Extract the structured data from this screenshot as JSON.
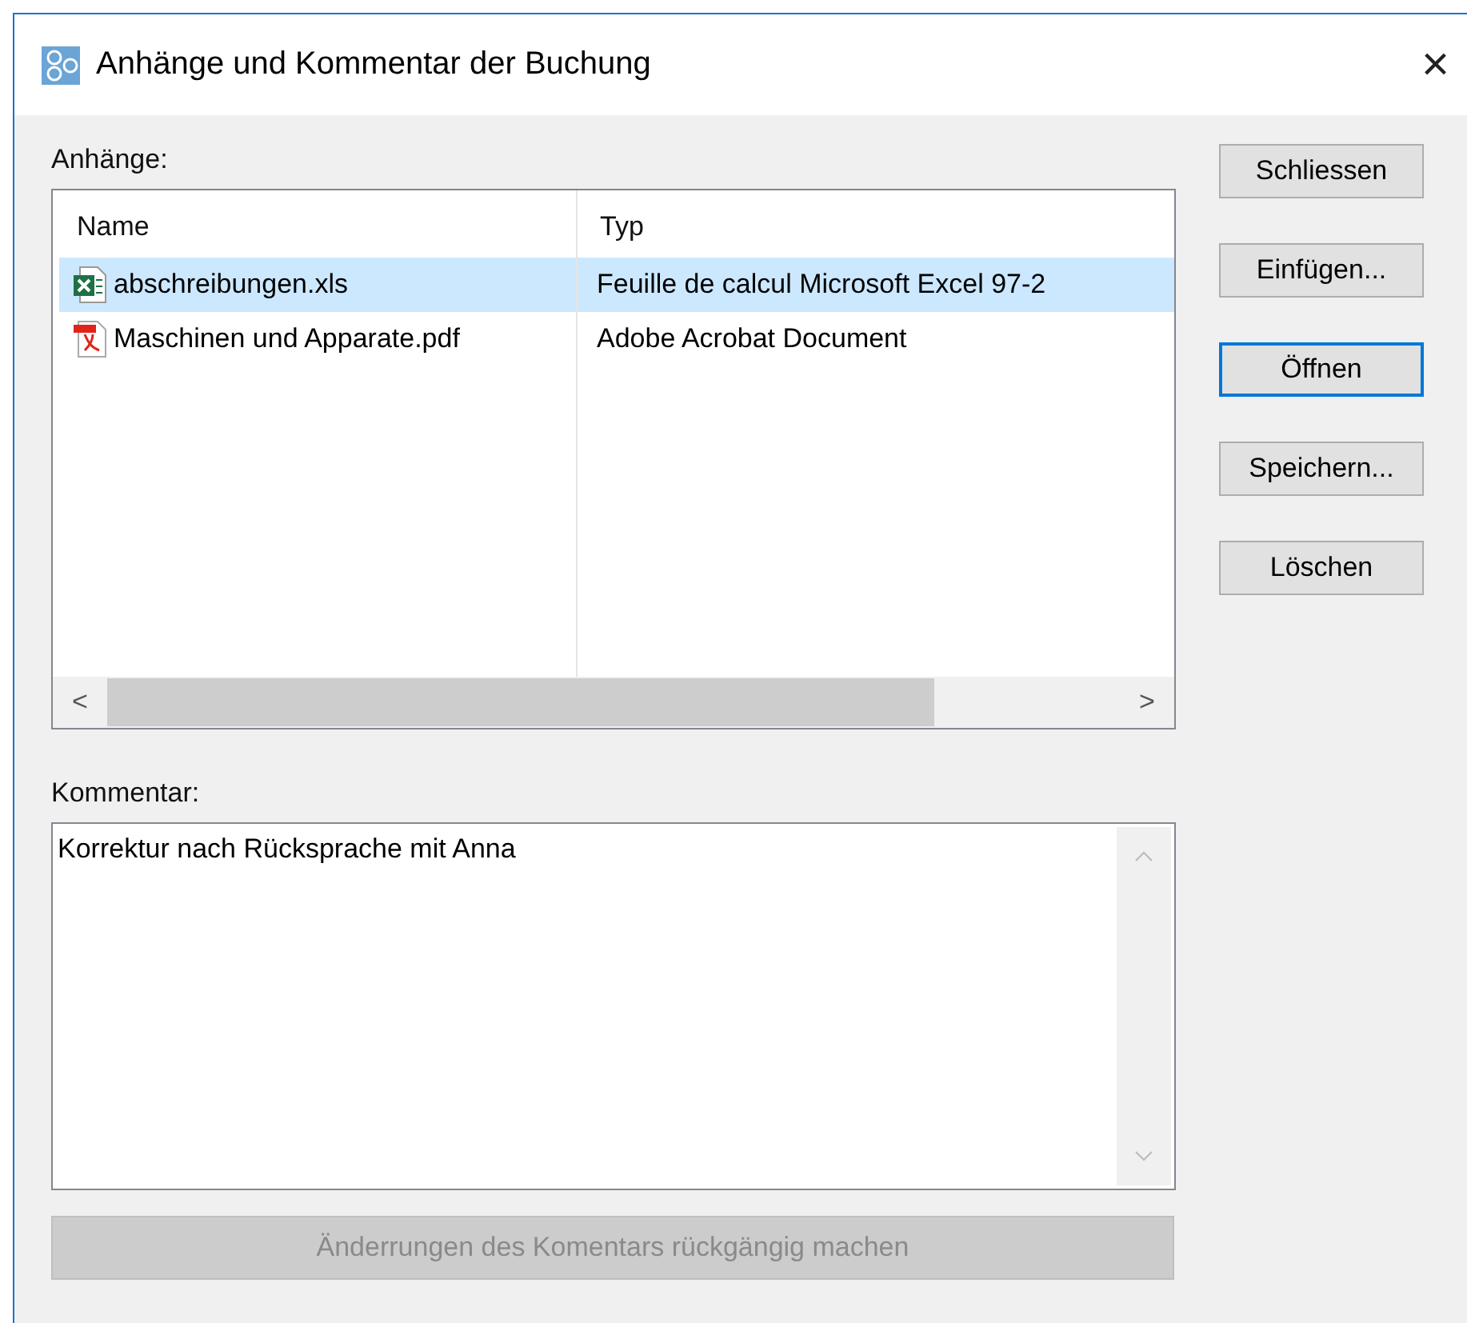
{
  "window": {
    "title": "Anhänge und Kommentar der Buchung",
    "close": "×"
  },
  "attachments": {
    "label": "Anhänge:",
    "columns": [
      "Name",
      "Typ"
    ],
    "rows": [
      {
        "kind": "excel",
        "name": "abschreibungen.xls",
        "type": "Feuille de calcul Microsoft Excel 97-2",
        "selected": true
      },
      {
        "kind": "pdf",
        "name": "Maschinen und Apparate.pdf",
        "type": "Adobe Acrobat Document",
        "selected": false
      }
    ],
    "scroll_left": "<",
    "scroll_right": ">"
  },
  "buttons": [
    {
      "label": "Schliessen",
      "focused": false
    },
    {
      "label": "Einfügen...",
      "focused": false
    },
    {
      "label": "Öffnen",
      "focused": true
    },
    {
      "label": "Speichern...",
      "focused": false
    },
    {
      "label": "Löschen",
      "focused": false
    }
  ],
  "comment": {
    "label": "Kommentar:",
    "value": "Korrektur nach Rücksprache mit Anna"
  },
  "undo_button": {
    "label": "Änderrungen des Komentars rückgängig machen",
    "disabled": true
  }
}
